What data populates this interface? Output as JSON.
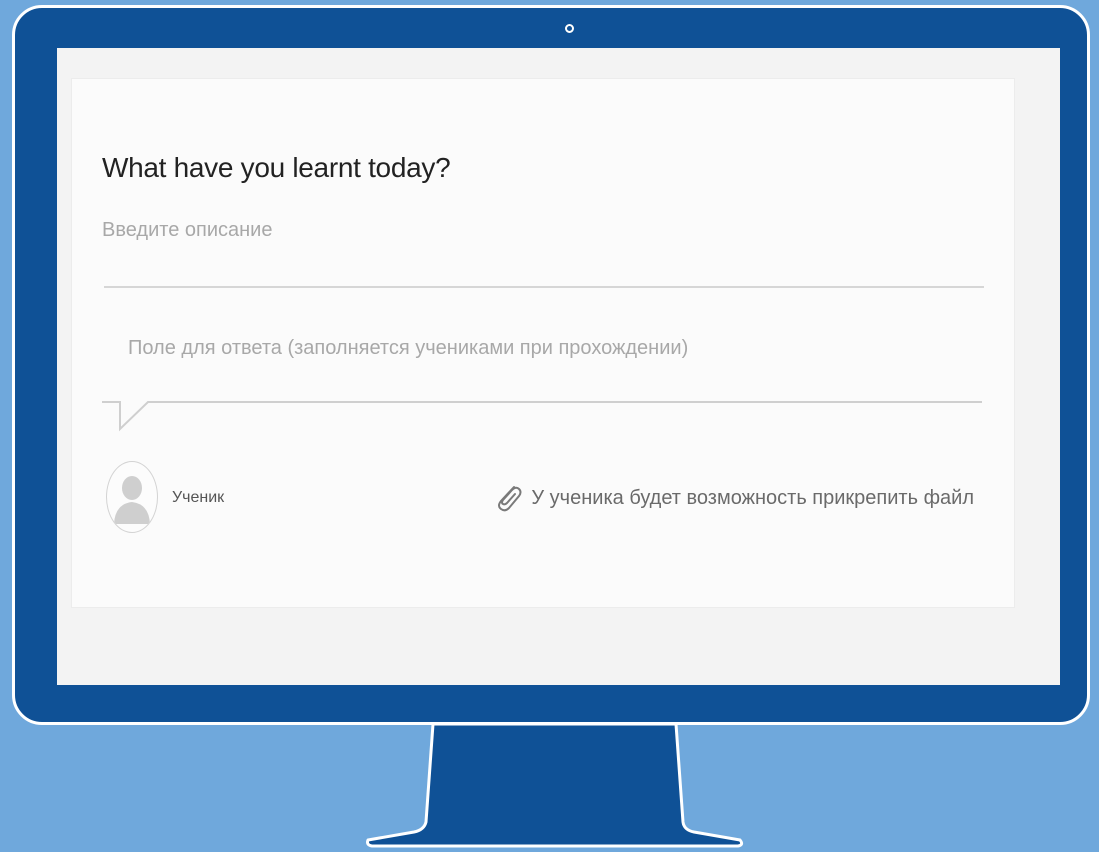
{
  "question": {
    "title": "What have you learnt today?",
    "description_placeholder": "Введите описание",
    "answer_placeholder": "Поле для ответа (заполняется учениками при прохождении)"
  },
  "student": {
    "label": "Ученик",
    "attach_text": "У ученика будет возможность прикрепить файл"
  },
  "icons": {
    "avatar": "user-avatar-icon",
    "attach": "paperclip-icon",
    "bubble": "speech-bubble-tail-icon"
  },
  "colors": {
    "background": "#6fa8dc",
    "monitor": "#0f5196",
    "screen": "#f3f3f3"
  }
}
